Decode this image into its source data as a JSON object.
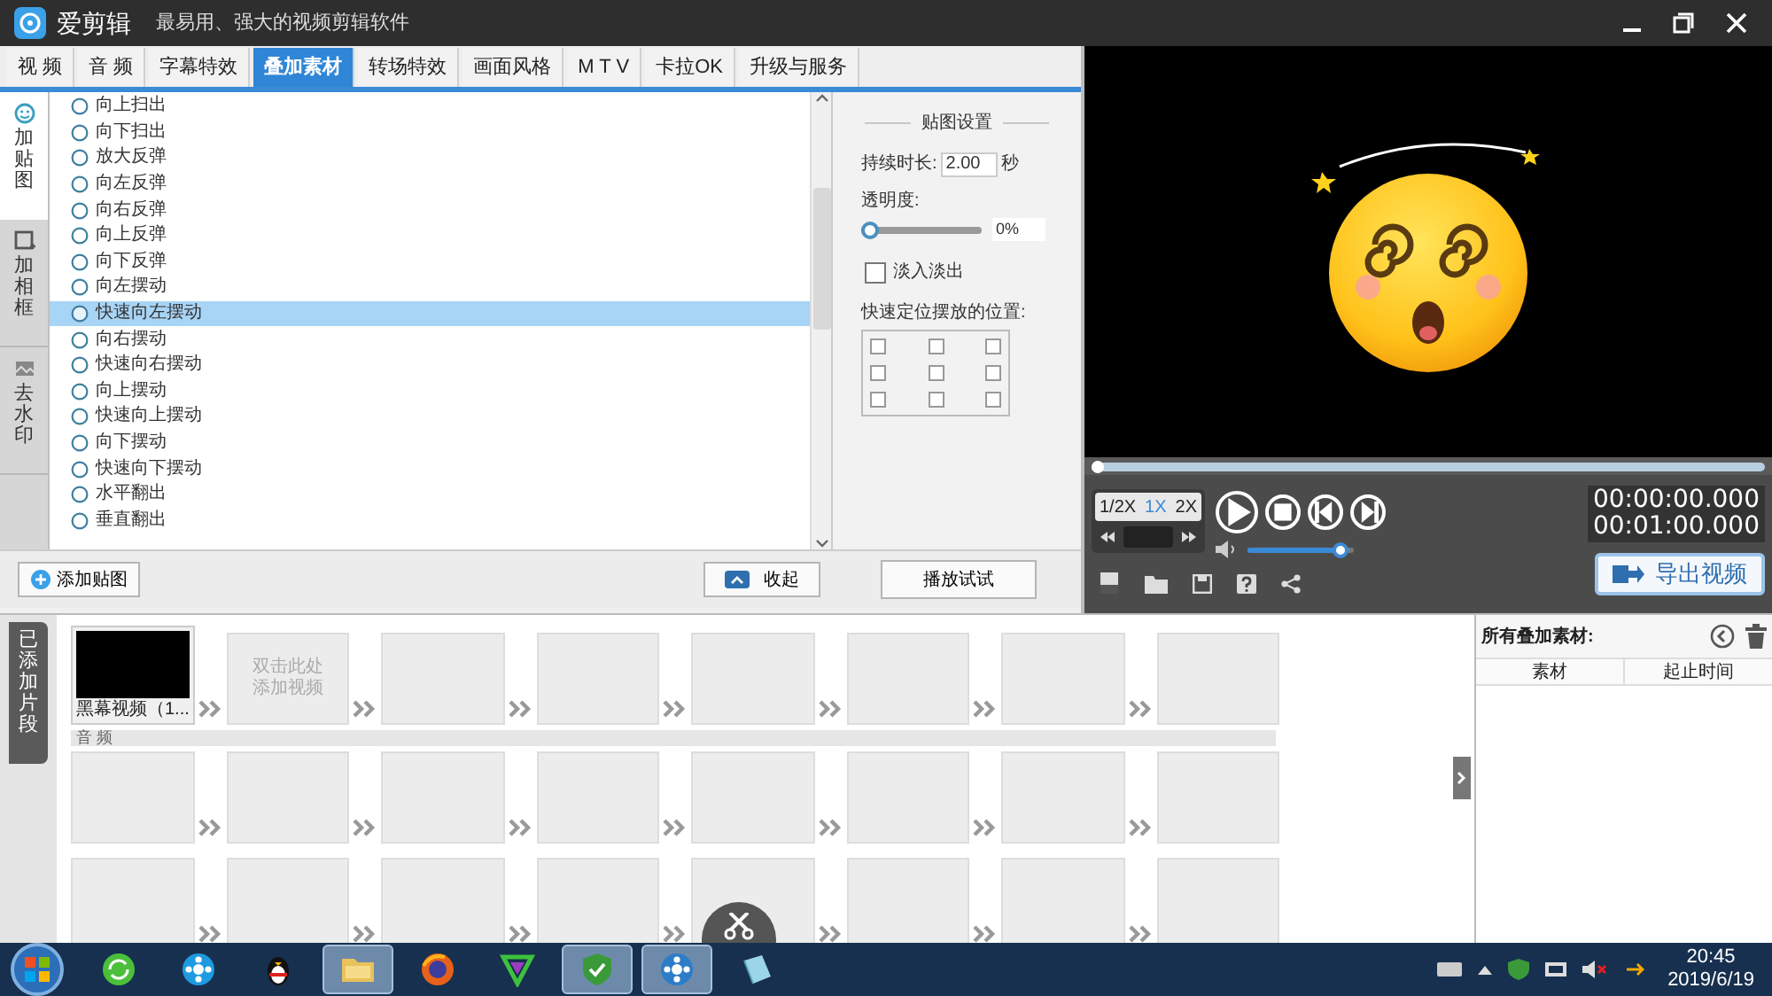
{
  "app": {
    "title": "爱剪辑",
    "slogan": "最易用、强大的视频剪辑软件"
  },
  "tabs": [
    {
      "label": "视 频",
      "selected": false
    },
    {
      "label": "音 频",
      "selected": false
    },
    {
      "label": "字幕特效",
      "selected": false
    },
    {
      "label": "叠加素材",
      "selected": true
    },
    {
      "label": "转场特效",
      "selected": false
    },
    {
      "label": "画面风格",
      "selected": false
    },
    {
      "label": "M T V",
      "selected": false
    },
    {
      "label": "卡拉OK",
      "selected": false
    },
    {
      "label": "升级与服务",
      "selected": false
    }
  ],
  "side_tabs": [
    {
      "kind": "sticker",
      "label": "加贴图",
      "selected": true
    },
    {
      "kind": "frame",
      "label": "加相框",
      "selected": false
    },
    {
      "kind": "watermark",
      "label": "去水印",
      "selected": false
    }
  ],
  "effects": [
    {
      "label": "向上扫出",
      "selected": false
    },
    {
      "label": "向下扫出",
      "selected": false
    },
    {
      "label": "放大反弹",
      "selected": false
    },
    {
      "label": "向左反弹",
      "selected": false
    },
    {
      "label": "向右反弹",
      "selected": false
    },
    {
      "label": "向上反弹",
      "selected": false
    },
    {
      "label": "向下反弹",
      "selected": false
    },
    {
      "label": "向左摆动",
      "selected": false
    },
    {
      "label": "快速向左摆动",
      "selected": true
    },
    {
      "label": "向右摆动",
      "selected": false
    },
    {
      "label": "快速向右摆动",
      "selected": false
    },
    {
      "label": "向上摆动",
      "selected": false
    },
    {
      "label": "快速向上摆动",
      "selected": false
    },
    {
      "label": "向下摆动",
      "selected": false
    },
    {
      "label": "快速向下摆动",
      "selected": false
    },
    {
      "label": "水平翻出",
      "selected": false
    },
    {
      "label": "垂直翻出",
      "selected": false
    }
  ],
  "settings": {
    "title": "贴图设置",
    "duration_label": "持续时长:",
    "duration": "2.00",
    "duration_unit": "秒",
    "opacity_label": "透明度:",
    "opacity": {
      "level": 0
    },
    "opacity_value": "0%",
    "fade": {
      "label": "淡入淡出",
      "checked": false
    },
    "position_label": "快速定位摆放的位置:",
    "positions": [
      {
        "checked": false
      },
      {
        "checked": false
      },
      {
        "checked": false
      },
      {
        "checked": false
      },
      {
        "checked": false
      },
      {
        "checked": false
      },
      {
        "checked": false
      },
      {
        "checked": false
      },
      {
        "checked": false
      }
    ]
  },
  "buttons": {
    "add_sticker": "添加贴图",
    "collapse": "收起",
    "preview": "播放试试"
  },
  "player": {
    "progress": {
      "level": 0
    },
    "speeds": [
      {
        "label": "1/2X",
        "selected": false
      },
      {
        "label": "1X",
        "selected": true
      },
      {
        "label": "2X",
        "selected": false
      }
    ],
    "volume": {
      "level": 0.95
    },
    "time_current": "00:00:00.000",
    "time_total": "00:01:00.000",
    "export": "导出视频"
  },
  "timeline": {
    "side_label": "已添加片段",
    "video": [
      {
        "kind": "clip",
        "label": "黑幕视频（1..."
      },
      {
        "kind": "add",
        "label": "双击此处添加视频"
      },
      {
        "kind": "empty"
      },
      {
        "kind": "empty"
      },
      {
        "kind": "empty"
      },
      {
        "kind": "empty"
      },
      {
        "kind": "empty"
      },
      {
        "kind": "empty"
      }
    ],
    "audio_label": "音 频",
    "audio": [
      {
        "kind": "empty"
      },
      {
        "kind": "empty"
      },
      {
        "kind": "empty"
      },
      {
        "kind": "empty"
      },
      {
        "kind": "empty"
      },
      {
        "kind": "empty"
      },
      {
        "kind": "empty"
      },
      {
        "kind": "empty"
      }
    ],
    "extra": [
      {
        "kind": "empty"
      },
      {
        "kind": "empty"
      },
      {
        "kind": "empty"
      },
      {
        "kind": "empty"
      },
      {
        "kind": "empty"
      },
      {
        "kind": "empty"
      },
      {
        "kind": "empty"
      },
      {
        "kind": "empty"
      }
    ]
  },
  "overlay_list": {
    "title": "所有叠加素材:",
    "columns": [
      "素材",
      "起止时间"
    ]
  },
  "taskbar": {
    "apps": [
      {
        "kind": "refresh",
        "active": false
      },
      {
        "kind": "film",
        "active": false
      },
      {
        "kind": "penguin",
        "active": false
      },
      {
        "kind": "folder",
        "active": true
      },
      {
        "kind": "browser",
        "active": false
      },
      {
        "kind": "triangle",
        "active": false
      },
      {
        "kind": "shield",
        "active": true
      },
      {
        "kind": "editor",
        "active": true
      },
      {
        "kind": "box",
        "active": false
      }
    ],
    "time": "20:45",
    "date": "2019/6/19"
  }
}
